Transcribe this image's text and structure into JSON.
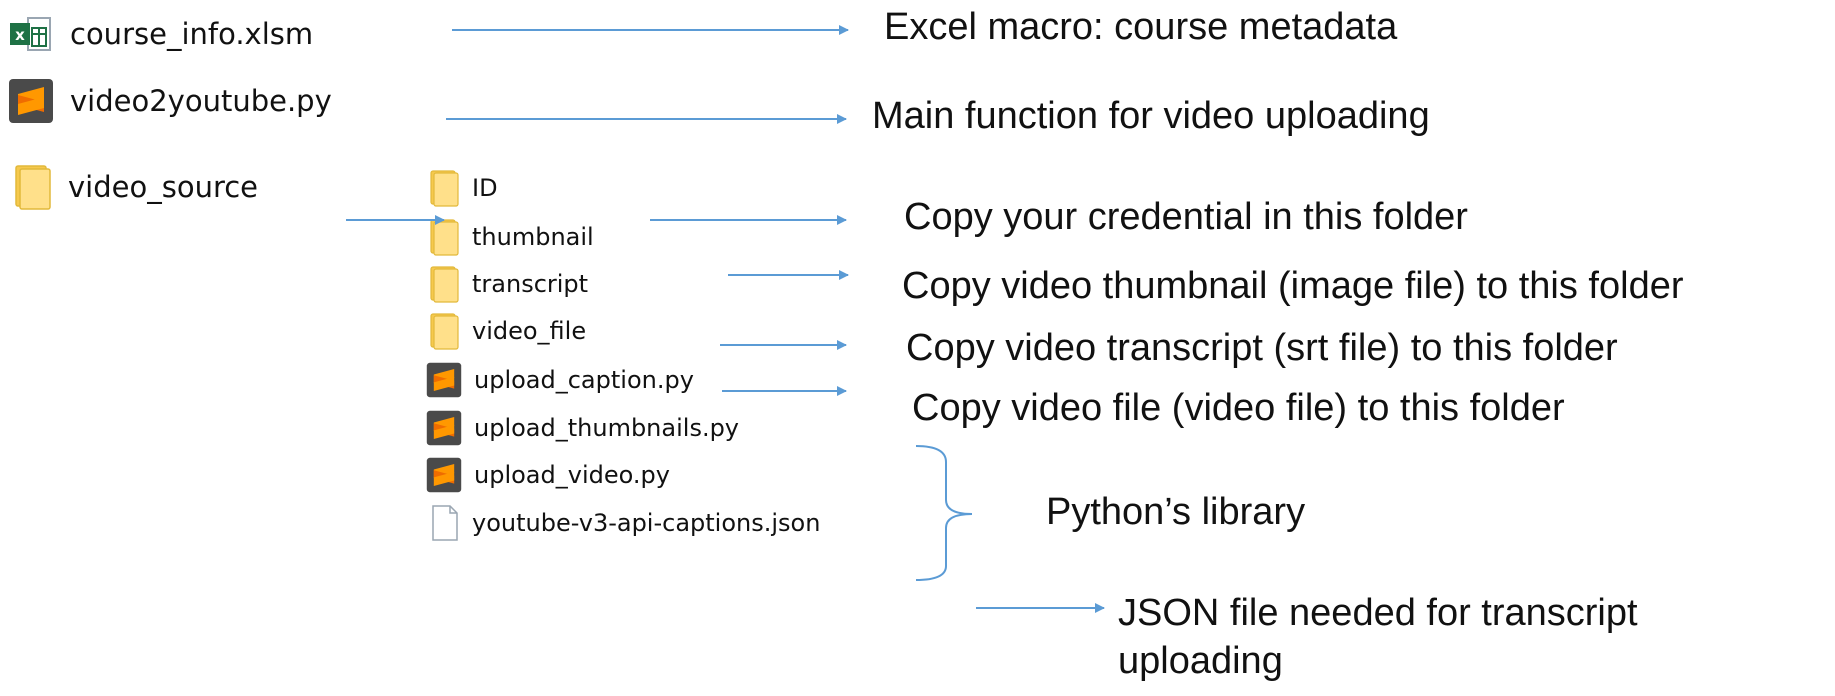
{
  "colors": {
    "arrow": "#5b9bd5",
    "folder": "#ffe08a",
    "folder_edge": "#e2b93b",
    "sublime_bg": "#4a4a4a",
    "sublime_s": "#ff9800",
    "excel": "#1e7145"
  },
  "root_items": [
    {
      "name": "course_info.xlsm",
      "icon": "excel-file-icon"
    },
    {
      "name": "video2youtube.py",
      "icon": "sublime-python-file-icon"
    },
    {
      "name": "video_source",
      "icon": "folder-icon"
    }
  ],
  "sub_items": [
    {
      "name": "ID",
      "icon": "folder-icon"
    },
    {
      "name": "thumbnail",
      "icon": "folder-icon"
    },
    {
      "name": "transcript",
      "icon": "folder-icon"
    },
    {
      "name": "video_file",
      "icon": "folder-icon"
    },
    {
      "name": "upload_caption.py",
      "icon": "sublime-python-file-icon"
    },
    {
      "name": "upload_thumbnails.py",
      "icon": "sublime-python-file-icon"
    },
    {
      "name": "upload_video.py",
      "icon": "sublime-python-file-icon"
    },
    {
      "name": "youtube-v3-api-captions.json",
      "icon": "blank-file-icon"
    }
  ],
  "annotations": {
    "course_info": "Excel macro: course metadata",
    "video2youtube": "Main function for video uploading",
    "id_folder": "Copy your credential in this folder",
    "thumbnail_folder": "Copy video thumbnail (image file) to this folder",
    "transcript_folder": "Copy video transcript (srt file) to this folder",
    "video_file_folder": "Copy video file (video file) to this folder",
    "python_library": "Python’s library",
    "json_file": "JSON file needed for transcript uploading"
  }
}
